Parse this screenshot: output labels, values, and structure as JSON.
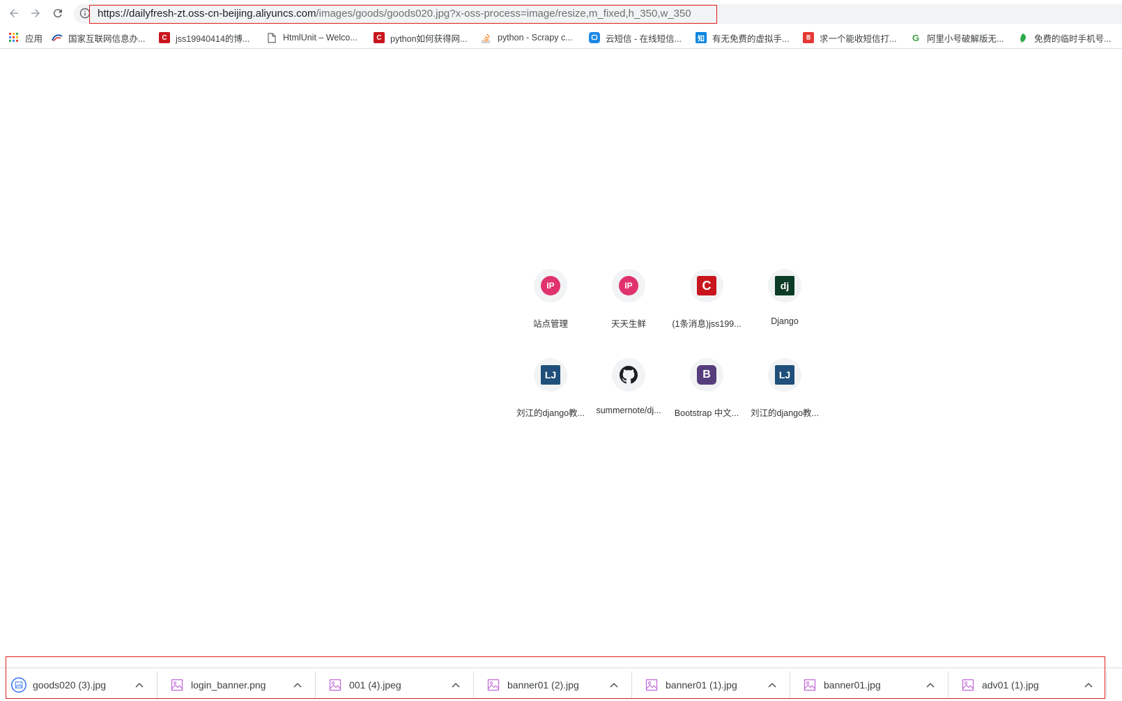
{
  "address_bar": {
    "url_host": "https://dailyfresh-zt.oss-cn-beijing.aliyuncs.com",
    "url_path": "/images/goods/goods020.jpg?x-oss-process=image/resize,m_fixed,h_350,w_350"
  },
  "bookmarks": [
    {
      "label": "应用",
      "icon": "apps-grid-icon",
      "color": "#ea4335"
    },
    {
      "label": "国家互联网信息办...",
      "icon": "cac-icon",
      "color": "#1a5ea8"
    },
    {
      "label": "jss19940414的博...",
      "icon": "csdn-icon",
      "color": "#c9151e",
      "glyph": "C"
    },
    {
      "label": "HtmlUnit – Welco...",
      "icon": "page-icon",
      "color": "#5f6368"
    },
    {
      "label": "python如何获得网...",
      "icon": "csdn-icon",
      "color": "#c9151e",
      "glyph": "C"
    },
    {
      "label": "python - Scrapy c...",
      "icon": "stackoverflow-icon",
      "color": "#f48024"
    },
    {
      "label": "云短信 - 在线短信...",
      "icon": "cloud-sms-icon",
      "color": "#1e88e5"
    },
    {
      "label": "有无免费的虚拟手...",
      "icon": "zhihu-icon",
      "color": "#0a84e0",
      "glyph": "知"
    },
    {
      "label": "求一个能收短信打...",
      "icon": "forum-icon",
      "color": "#e53935",
      "glyph": "吾"
    },
    {
      "label": "阿里小号破解版无...",
      "icon": "g-plus-icon",
      "color": "#43a047",
      "glyph": "G"
    },
    {
      "label": "免费的临时手机号...",
      "icon": "leaf-icon",
      "color": "#2e7d32"
    }
  ],
  "shortcuts": [
    {
      "label": "站点管理",
      "icon": "ip-icon",
      "glyph": "IP",
      "color": "#e0336e"
    },
    {
      "label": "天天生鲜",
      "icon": "ip-icon",
      "glyph": "IP",
      "color": "#e0336e"
    },
    {
      "label": "(1条消息)jss199...",
      "icon": "csdn-icon",
      "glyph": "C",
      "color": "#c9151e"
    },
    {
      "label": "Django",
      "icon": "django-icon",
      "glyph": "dj",
      "color": "#0c3c26"
    },
    {
      "label": "刘江的django教...",
      "icon": "lj-icon",
      "glyph": "LJ",
      "color": "#1f4f7a"
    },
    {
      "label": "summernote/dj...",
      "icon": "github-icon",
      "glyph": "",
      "color": "#1b1f23"
    },
    {
      "label": "Bootstrap 中文...",
      "icon": "bootstrap-icon",
      "glyph": "B",
      "color": "#563d7c"
    },
    {
      "label": "刘江的django教...",
      "icon": "lj-icon",
      "glyph": "LJ",
      "color": "#1f4f7a"
    }
  ],
  "downloads": [
    {
      "name": "goods020 (3).jpg",
      "icon": "image-file-icon-active"
    },
    {
      "name": "login_banner.png",
      "icon": "image-file-icon"
    },
    {
      "name": "001 (4).jpeg",
      "icon": "image-file-icon"
    },
    {
      "name": "banner01 (2).jpg",
      "icon": "image-file-icon"
    },
    {
      "name": "banner01 (1).jpg",
      "icon": "image-file-icon"
    },
    {
      "name": "banner01.jpg",
      "icon": "image-file-icon"
    },
    {
      "name": "adv01 (1).jpg",
      "icon": "image-file-icon"
    }
  ]
}
